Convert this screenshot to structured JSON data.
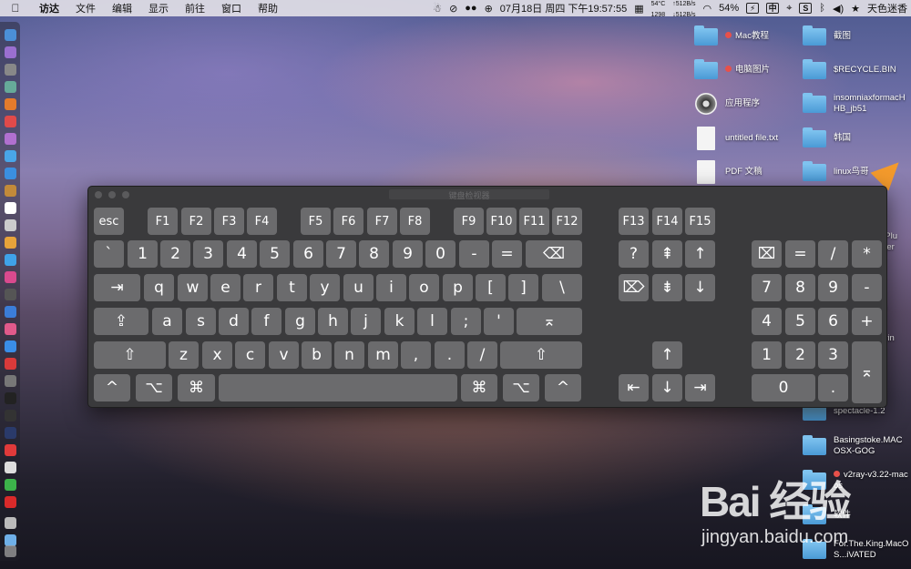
{
  "menubar": {
    "apple": "",
    "app": "访达",
    "menus": [
      "文件",
      "编辑",
      "显示",
      "前往",
      "窗口",
      "帮助"
    ],
    "cpu_temp": "54°C",
    "fan": "1298",
    "net_up": "↑512B/s",
    "net_down": "↓512B/s",
    "datetime": "07月18日 周四 下午19:57:55",
    "battery": "54%",
    "input_method": "中",
    "user": "天色迷香"
  },
  "desktop": {
    "items": [
      {
        "label": "Mac教程",
        "dot": true
      },
      {
        "label": "电脑图片",
        "dot": true
      },
      {
        "label": "应用程序"
      },
      {
        "label": "untitled file.txt"
      },
      {
        "label": "PDF 文稿"
      },
      {
        "label": "截图"
      },
      {
        "label": "$RECYCLE.BIN"
      },
      {
        "label": "insomniaxformacHHB_jb51"
      },
      {
        "label": "韩国"
      },
      {
        "label": "linux鸟哥"
      },
      {
        "label": "spectacle-1.2"
      },
      {
        "label": "Basingstoke.MACOSX-GOG"
      },
      {
        "label": "v2ray-v3.22-macos",
        "dot": true
      },
      {
        "label": "软件"
      },
      {
        "label": "For.The.King.MacOS...iVATED"
      }
    ],
    "partial_labels": [
      "t.Plu",
      "ster",
      "erin",
      "0"
    ]
  },
  "keyboard": {
    "title": "键盘检视器",
    "rows": {
      "fn": [
        "esc",
        "F1",
        "F2",
        "F3",
        "F4",
        "F5",
        "F6",
        "F7",
        "F8",
        "F9",
        "F10",
        "F11",
        "F12",
        "F13",
        "F14",
        "F15"
      ],
      "num": [
        "`",
        "1",
        "2",
        "3",
        "4",
        "5",
        "6",
        "7",
        "8",
        "9",
        "0",
        "-",
        "=",
        "⌫",
        "?",
        "⇞",
        "↑",
        "⌧",
        "=",
        "/",
        "*"
      ],
      "tab": [
        "⇥",
        "q",
        "w",
        "e",
        "r",
        "t",
        "y",
        "u",
        "i",
        "o",
        "p",
        "[",
        "]",
        "\\",
        "⌦",
        "⇟",
        "↓",
        "7",
        "8",
        "9",
        "-"
      ],
      "caps": [
        "⇪",
        "a",
        "s",
        "d",
        "f",
        "g",
        "h",
        "j",
        "k",
        "l",
        ";",
        "'",
        "⌅",
        "4",
        "5",
        "6",
        "+"
      ],
      "shift": [
        "⇧",
        "z",
        "x",
        "c",
        "v",
        "b",
        "n",
        "m",
        ",",
        ".",
        "/",
        "⇧",
        "↑",
        "1",
        "2",
        "3",
        "⌅"
      ],
      "bottom": [
        "^",
        "⌥",
        "⌘",
        "",
        "⌘",
        "⌥",
        "^",
        "⇤",
        "↓",
        "⇥",
        "0",
        "."
      ]
    }
  },
  "watermark": {
    "logo": "Bai 经验",
    "url": "jingyan.baidu.com"
  },
  "colors": {
    "key": "#6b6b6d",
    "window": "#3a3a3c",
    "folder": "#5aa9e0",
    "cursor": "#f39a2c"
  }
}
